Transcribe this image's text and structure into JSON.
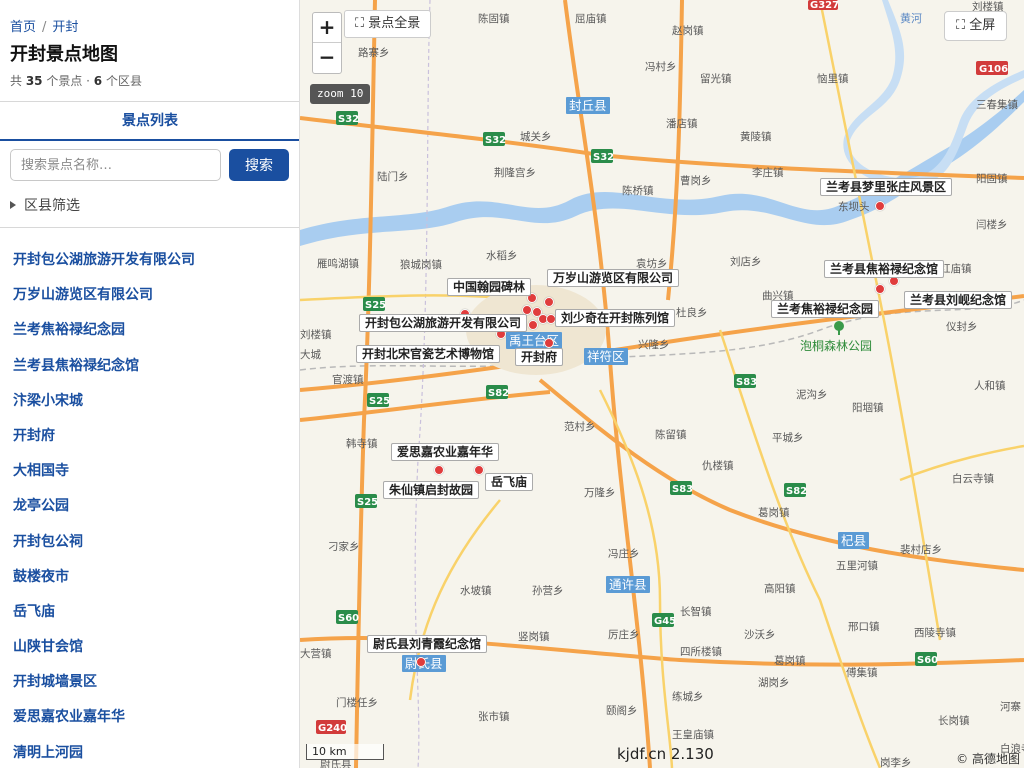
{
  "breadcrumb": {
    "home": "首页",
    "separator": "/",
    "current": "开封"
  },
  "sidebar": {
    "title": "开封景点地图",
    "stats": {
      "prefix": "共 ",
      "poi_count": "35",
      "poi_unit": " 个景点 · ",
      "district_count": "6",
      "district_unit": " 个区县"
    },
    "tab_label": "景点列表",
    "search_placeholder": "搜索景点名称…",
    "search_button": "搜索",
    "filter_label": "区县筛选",
    "poi_list": [
      "开封包公湖旅游开发有限公司",
      "万岁山游览区有限公司",
      "兰考焦裕禄纪念园",
      "兰考县焦裕禄纪念馆",
      "汴梁小宋城",
      "开封府",
      "大相国寺",
      "龙亭公园",
      "开封包公祠",
      "鼓楼夜市",
      "岳飞庙",
      "山陕甘会馆",
      "开封城墙景区",
      "爱思嘉农业嘉年华",
      "清明上河园"
    ]
  },
  "map": {
    "zoom_in": "+",
    "zoom_out": "−",
    "scenic_all_button": "⛶ 景点全景",
    "fullscreen_button": "⛶ 全屏",
    "zoom_badge": "zoom 10",
    "scale_label": "10 km",
    "watermark": "kjdf.cn 2.130",
    "copyright": "© 高德地图",
    "poi_labels": [
      "中国翰园碑林",
      "万岁山游览区有限公司",
      "开封包公湖旅游开发有限公司",
      "刘少奇在开封陈列馆",
      "开封北宋官瓷艺术博物馆",
      "开封府",
      "爱思嘉农业嘉年华",
      "岳飞庙",
      "朱仙镇启封故园",
      "尉氏县刘青霞纪念馆",
      "兰考县梦里张庄风景区",
      "兰考县焦裕禄纪念馆",
      "兰考焦裕禄纪念园",
      "兰考县刘岘纪念馆"
    ],
    "district_tags": [
      "封丘县",
      "禹王台区",
      "祥符区",
      "通许县",
      "杞县",
      "尉氏县"
    ],
    "park_label": "泡桐森林公园",
    "river_label": "黄河",
    "road_shields": [
      "S32",
      "S32",
      "S32",
      "S25",
      "S25",
      "S25",
      "S82",
      "S82",
      "S83",
      "S83",
      "S60",
      "S60",
      "G45",
      "G327",
      "G106",
      "G240"
    ],
    "place_labels": [
      "陈固镇",
      "屈庙镇",
      "赵岗镇",
      "冯村乡",
      "留光镇",
      "恼里镇",
      "三春集镇",
      "刘楼镇",
      "路寨乡",
      "潘店镇",
      "黄陵镇",
      "城关乡",
      "荆隆宫乡",
      "陈桥镇",
      "曹岗乡",
      "李庄镇",
      "陆门乡",
      "东坝头",
      "阳固镇",
      "闫楼乡",
      "水稻乡",
      "袁坊乡",
      "刘店乡",
      "红庙镇",
      "狼城岗镇",
      "雁鸣湖镇",
      "曲兴镇",
      "杜良乡",
      "兴隆乡",
      "泥沟乡",
      "仪封乡",
      "官渡镇",
      "范村乡",
      "陈留镇",
      "阳堌镇",
      "韩寺镇",
      "平城乡",
      "仇楼镇",
      "万隆乡",
      "葛岗镇",
      "白云寺镇",
      "刁家乡",
      "冯庄乡",
      "五里河镇",
      "裴村店乡",
      "水坡镇",
      "孙营乡",
      "高阳镇",
      "长智镇",
      "竖岗镇",
      "厉庄乡",
      "沙沃乡",
      "邢口镇",
      "西陵寺镇",
      "大营镇",
      "四所楼镇",
      "葛岗镇",
      "傅集镇",
      "湖岗乡",
      "练城乡",
      "门楼任乡",
      "张市镇",
      "颐阁乡",
      "王皇庙镇",
      "长岗镇",
      "河寨",
      "尉氏县",
      "岗李乡",
      "大城",
      "白浪寺",
      "人和镇",
      "刘楼镇"
    ]
  }
}
